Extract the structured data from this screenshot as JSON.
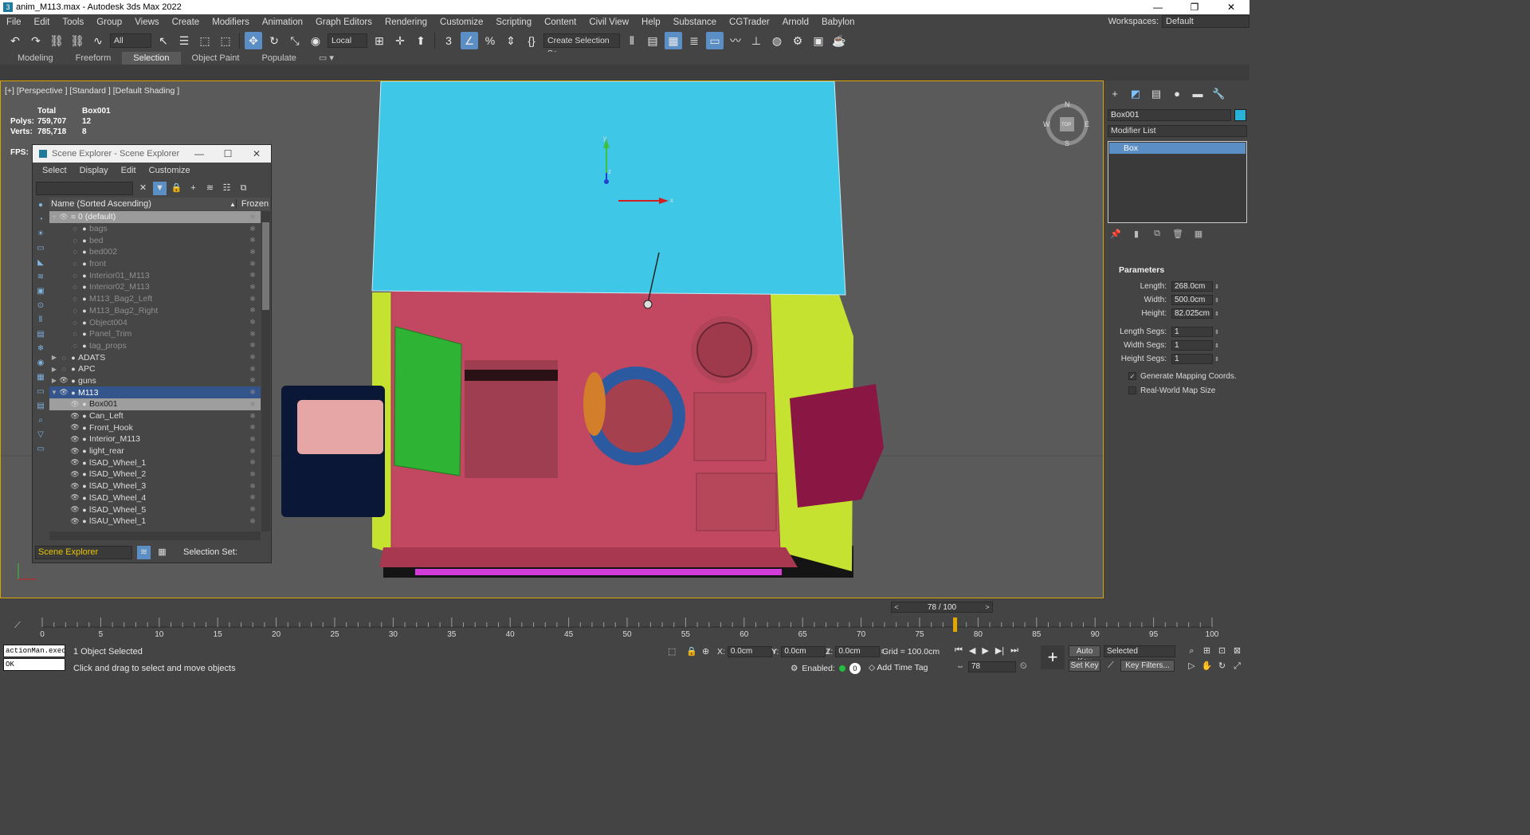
{
  "window": {
    "title": "anim_M113.max - Autodesk 3ds Max 2022",
    "minimize": "—",
    "restore": "❐",
    "close": "✕"
  },
  "menu": [
    "File",
    "Edit",
    "Tools",
    "Group",
    "Views",
    "Create",
    "Modifiers",
    "Animation",
    "Graph Editors",
    "Rendering",
    "Customize",
    "Scripting",
    "Content",
    "Civil View",
    "Help",
    "Substance",
    "CGTrader",
    "Arnold",
    "Babylon"
  ],
  "workspace": {
    "label": "Workspaces:",
    "value": "Default"
  },
  "toolbar": {
    "filter": "All",
    "reference_coord": "Local",
    "selection_set": "Create Selection Se"
  },
  "ribbon_tabs": [
    "Modeling",
    "Freeform",
    "Selection",
    "Object Paint",
    "Populate"
  ],
  "viewport": {
    "label": "[+] [Perspective ] [Standard ] [Default Shading ]",
    "stats": {
      "header_total": "Total",
      "header_obj": "Box001",
      "polys_label": "Polys:",
      "polys_total": "759,707",
      "polys_obj": "12",
      "verts_label": "Verts:",
      "verts_total": "785,718",
      "verts_obj": "8"
    },
    "fps_label": "FPS:",
    "gizmo": {
      "x": "x",
      "y": "y",
      "z": "z"
    },
    "viewcube": {
      "n": "N",
      "s": "S",
      "e": "E",
      "w": "W",
      "top": "TOP"
    }
  },
  "scene_explorer": {
    "title": "Scene Explorer - Scene Explorer",
    "menu": [
      "Select",
      "Display",
      "Edit",
      "Customize"
    ],
    "col_name": "Name (Sorted Ascending)",
    "col_frozen": "Frozen",
    "rows": [
      {
        "name": "0 (default)",
        "type": "layer",
        "exp": "▼"
      },
      {
        "name": "bags",
        "type": "dim"
      },
      {
        "name": "bed",
        "type": "dim"
      },
      {
        "name": "bed002",
        "type": "dim"
      },
      {
        "name": "front",
        "type": "dim"
      },
      {
        "name": "Interior01_M113",
        "type": "dim"
      },
      {
        "name": "Interior02_M113",
        "type": "dim"
      },
      {
        "name": "M113_Bag2_Left",
        "type": "dim"
      },
      {
        "name": "M113_Bag2_Right",
        "type": "dim"
      },
      {
        "name": "Object004",
        "type": "dim"
      },
      {
        "name": "Panel_Trim",
        "type": "dim"
      },
      {
        "name": "tag_props",
        "type": "dim"
      },
      {
        "name": "ADATS",
        "type": "group",
        "exp": "▶"
      },
      {
        "name": "APC",
        "type": "group",
        "exp": "▶"
      },
      {
        "name": "guns",
        "type": "normal",
        "exp": "▶"
      },
      {
        "name": "M113",
        "type": "sel",
        "exp": "▼"
      },
      {
        "name": "Box001",
        "type": "hl"
      },
      {
        "name": "Can_Left",
        "type": "normal"
      },
      {
        "name": "Front_Hook",
        "type": "normal"
      },
      {
        "name": "Interior_M113",
        "type": "normal"
      },
      {
        "name": "light_rear",
        "type": "normal"
      },
      {
        "name": "lSAD_Wheel_1",
        "type": "normal"
      },
      {
        "name": "lSAD_Wheel_2",
        "type": "normal"
      },
      {
        "name": "lSAD_Wheel_3",
        "type": "normal"
      },
      {
        "name": "lSAD_Wheel_4",
        "type": "normal"
      },
      {
        "name": "lSAD_Wheel_5",
        "type": "normal"
      },
      {
        "name": "lSAU_Wheel_1",
        "type": "normal"
      }
    ],
    "footer_explorer": "Scene Explorer",
    "footer_selset": "Selection Set:"
  },
  "command_panel": {
    "object_name": "Box001",
    "object_color": "#29b2d8",
    "modifier_list": "Modifier List",
    "stack": [
      "Box"
    ],
    "rollout": "Parameters",
    "params": [
      {
        "label": "Length:",
        "value": "268.0cm"
      },
      {
        "label": "Width:",
        "value": "500.0cm"
      },
      {
        "label": "Height:",
        "value": "82.025cm"
      },
      {
        "label": "Length Segs:",
        "value": "1"
      },
      {
        "label": "Width Segs:",
        "value": "1"
      },
      {
        "label": "Height Segs:",
        "value": "1"
      }
    ],
    "gen_mapping": "Generate Mapping Coords.",
    "real_world": "Real-World Map Size"
  },
  "timeline": {
    "frame_display": "78 / 100",
    "current_frame": 78,
    "ticks": [
      "0",
      "5",
      "10",
      "15",
      "20",
      "25",
      "30",
      "35",
      "40",
      "45",
      "50",
      "55",
      "60",
      "65",
      "70",
      "75",
      "80",
      "85",
      "90",
      "95",
      "100"
    ]
  },
  "status": {
    "maxscript_line1": "actionMan.execu",
    "maxscript_line2": "OK",
    "selected": "1 Object Selected",
    "prompt": "Click and drag to select and move objects",
    "x_label": "X:",
    "x_value": "0.0cm",
    "y_label": "Y:",
    "y_value": "0.0cm",
    "z_label": "Z:",
    "z_value": "0.0cm",
    "grid": "Grid = 100.0cm",
    "enabled": "Enabled:",
    "enabled_count": "0",
    "add_time_tag": "Add Time Tag",
    "frame_field": "78",
    "auto_key": "Auto Key",
    "set_key": "Set Key",
    "selected_filter": "Selected",
    "key_filters": "Key Filters..."
  }
}
